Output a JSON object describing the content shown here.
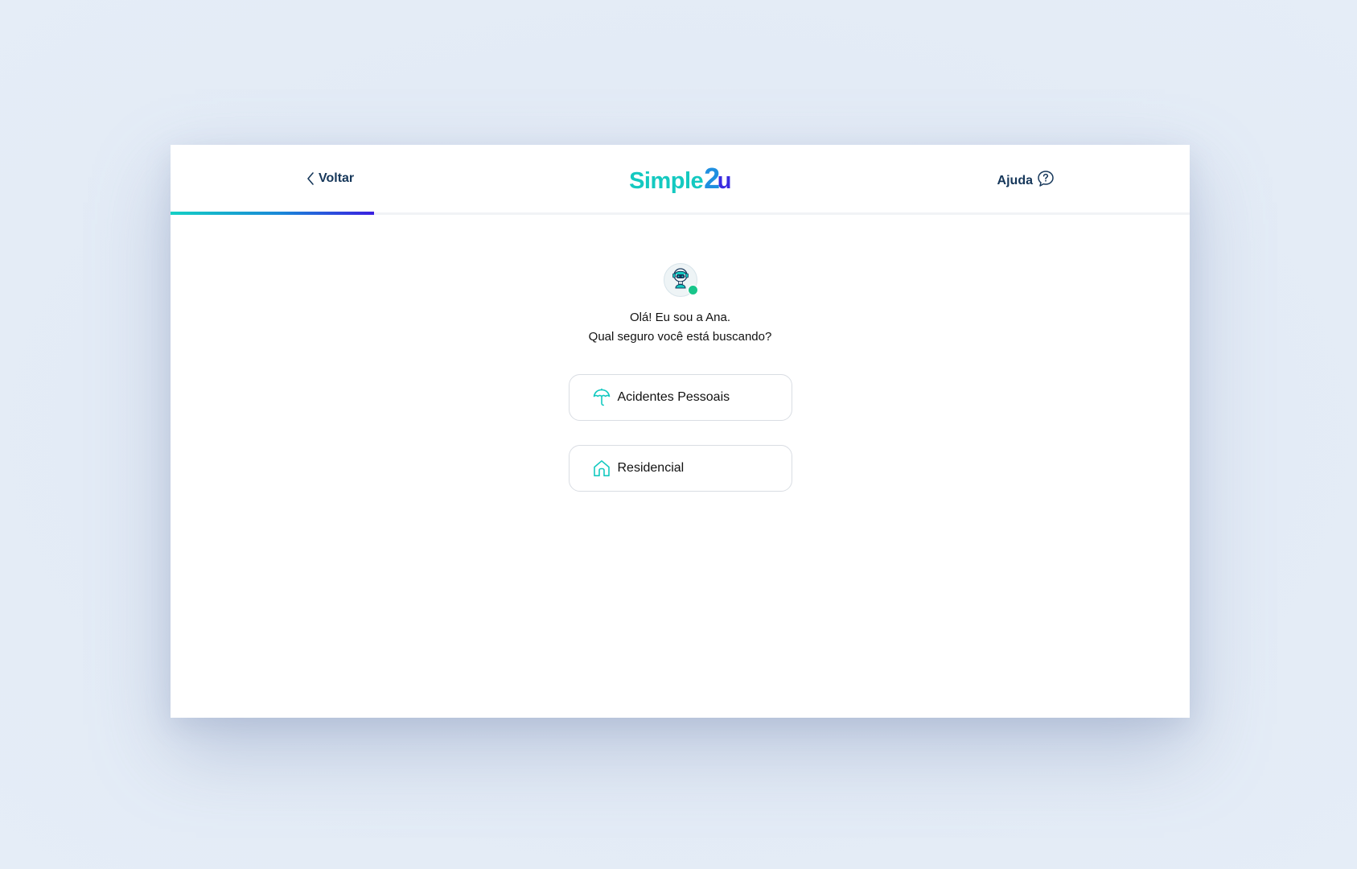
{
  "header": {
    "back_label": "Voltar",
    "logo": {
      "main": "Simple",
      "two": "2",
      "u": "u"
    },
    "help_label": "Ajuda",
    "progress_fraction": 0.2
  },
  "assistant": {
    "greeting_line1": "Olá! Eu sou a Ana.",
    "greeting_line2": "Qual seguro você está buscando?",
    "status": "online"
  },
  "options": [
    {
      "label": "Acidentes Pessoais",
      "icon": "umbrella-icon"
    },
    {
      "label": "Residencial",
      "icon": "house-icon"
    }
  ],
  "colors": {
    "accent_teal": "#14c9c0",
    "accent_blue": "#1f8fe0",
    "accent_indigo": "#3a2be0",
    "nav_text": "#16375a",
    "online": "#18c58a"
  }
}
